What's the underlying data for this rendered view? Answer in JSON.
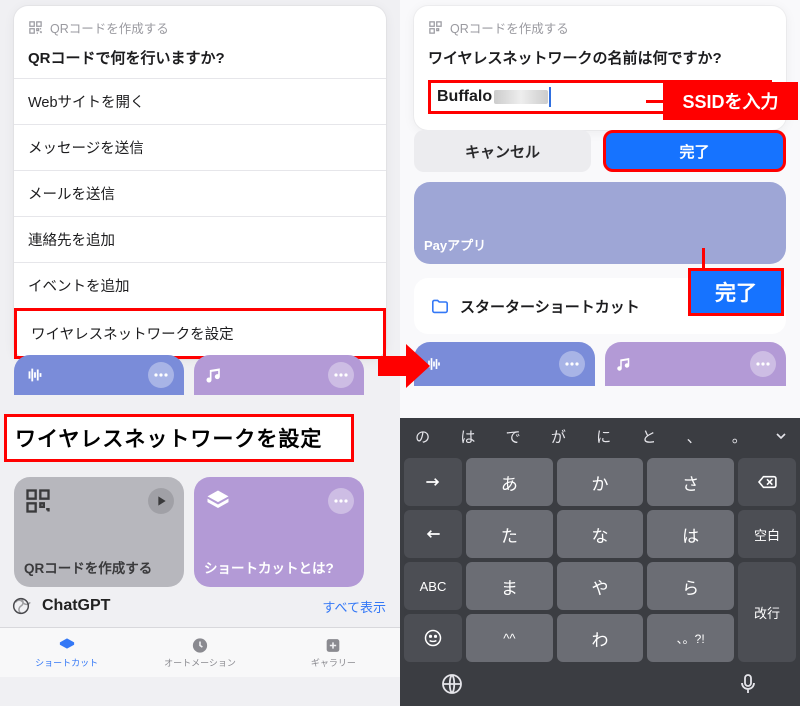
{
  "left": {
    "dialog": {
      "breadcrumb": "QRコードを作成する",
      "title": "QRコードで何を行いますか?",
      "items": [
        "Webサイトを開く",
        "メッセージを送信",
        "メールを送信",
        "連絡先を追加",
        "イベントを追加",
        "ワイヤレスネットワークを設定"
      ]
    },
    "callout": "ワイヤレスネットワークを設定",
    "cards": {
      "qr": "QRコードを作成する",
      "shortcut": "ショートカットとは?"
    },
    "section": {
      "chatgpt": "ChatGPT",
      "see_all": "すべて表示"
    },
    "tabs": {
      "shortcuts": "ショートカット",
      "automation": "オートメーション",
      "gallery": "ギャラリー"
    }
  },
  "right": {
    "dialog": {
      "breadcrumb": "QRコードを作成する",
      "title": "ワイヤレスネットワークの名前は何ですか?",
      "input_value": "Buffalo"
    },
    "ssid_callout": "SSIDを入力",
    "buttons": {
      "cancel": "キャンセル",
      "done": "完了"
    },
    "done_big": "完了",
    "pay_tile": "Payアプリ",
    "folder": {
      "label": "スターターショートカット"
    },
    "kbd": {
      "suggestions": [
        "の",
        "は",
        "で",
        "が",
        "に",
        "と",
        "、",
        "。"
      ],
      "rows": [
        [
          "→",
          "あ",
          "か",
          "さ",
          "⌫"
        ],
        [
          "←",
          "た",
          "な",
          "は",
          "空白"
        ],
        [
          "ABC",
          "ま",
          "や",
          "ら",
          "改行"
        ],
        [
          "☺",
          "^^",
          "わ",
          "、。?!",
          ""
        ]
      ]
    }
  }
}
